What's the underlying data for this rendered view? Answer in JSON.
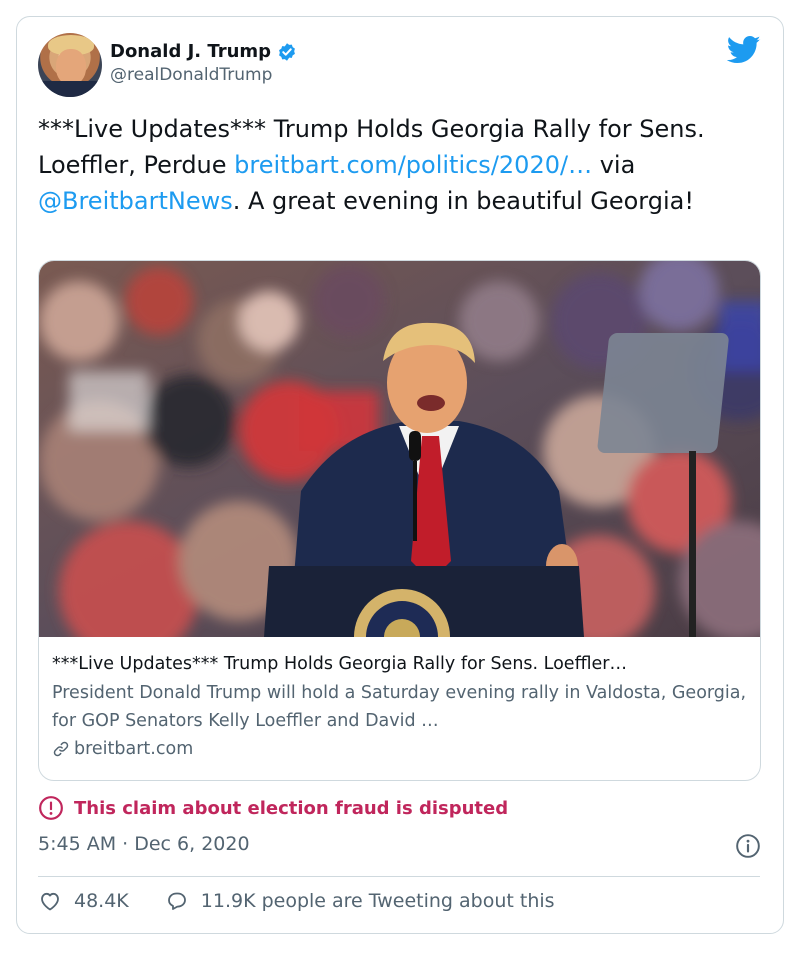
{
  "author": {
    "name": "Donald J. Trump",
    "handle": "@realDonaldTrump",
    "verified": true
  },
  "tweet": {
    "text_before": "***Live Updates*** Trump Holds Georgia Rally for Sens. Loeffler, Perdue ",
    "link_text": "breitbart.com/politics/2020/…",
    "text_via": " via ",
    "mention": "@BreitbartNews",
    "text_after": ". A great evening in beautiful Georgia!"
  },
  "link_card": {
    "title": "***Live Updates*** Trump Holds Georgia Rally for Sens. Loeffler…",
    "description": "President Donald Trump will hold a Saturday evening rally in Valdosta, Georgia, for GOP Senators Kelly Loeffler and David …",
    "domain": "breitbart.com"
  },
  "label": {
    "text": "This claim about election fraud is disputed"
  },
  "timestamp": "5:45 AM · Dec 6, 2020",
  "actions": {
    "likes": "48.4K",
    "tweeting": "11.9K people are Tweeting about this"
  },
  "colors": {
    "twitter_blue": "#1d9bf0",
    "label_red": "#c0265c",
    "secondary_text": "#536471"
  },
  "icons": [
    "verified-badge-icon",
    "twitter-bird-icon",
    "link-icon",
    "warning-circle-icon",
    "info-icon",
    "heart-icon",
    "reply-bubble-icon"
  ]
}
